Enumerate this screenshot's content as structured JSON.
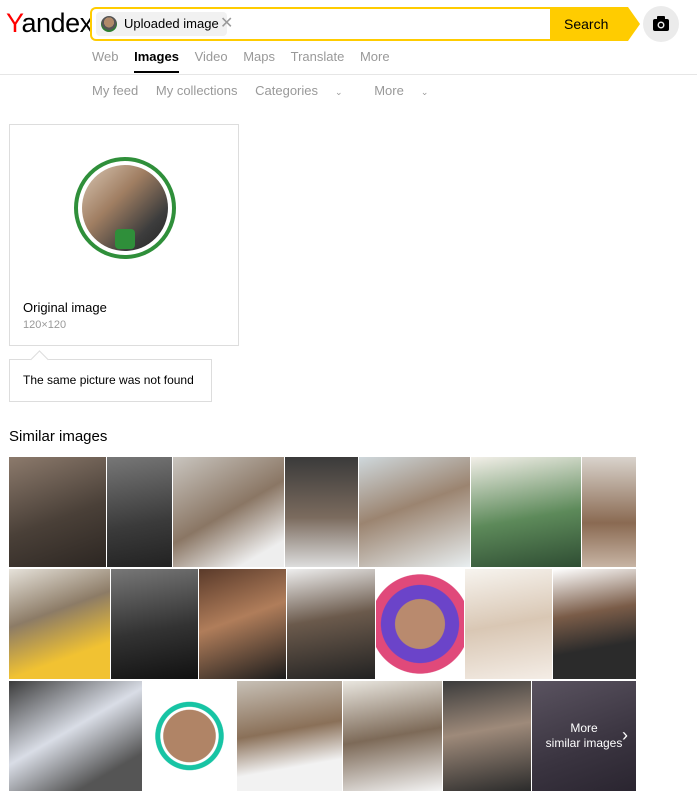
{
  "logo": {
    "first": "Y",
    "rest": "andex"
  },
  "search": {
    "chip_label": "Uploaded image",
    "button_label": "Search"
  },
  "tabs": [
    {
      "label": "Web",
      "active": false
    },
    {
      "label": "Images",
      "active": true
    },
    {
      "label": "Video",
      "active": false
    },
    {
      "label": "Maps",
      "active": false
    },
    {
      "label": "Translate",
      "active": false
    },
    {
      "label": "More",
      "active": false
    }
  ],
  "subnav": {
    "my_feed": "My feed",
    "my_collections": "My collections",
    "categories": "Categories",
    "more": "More"
  },
  "original": {
    "title": "Original image",
    "size": "120×120"
  },
  "not_found": "The same picture was not found",
  "similar": {
    "title": "Similar images",
    "more_line1": "More",
    "more_line2": "similar images"
  },
  "colors": {
    "accent": "#ffcc00",
    "logo_red": "#ff0000",
    "ring_green": "#2f8f3a"
  }
}
